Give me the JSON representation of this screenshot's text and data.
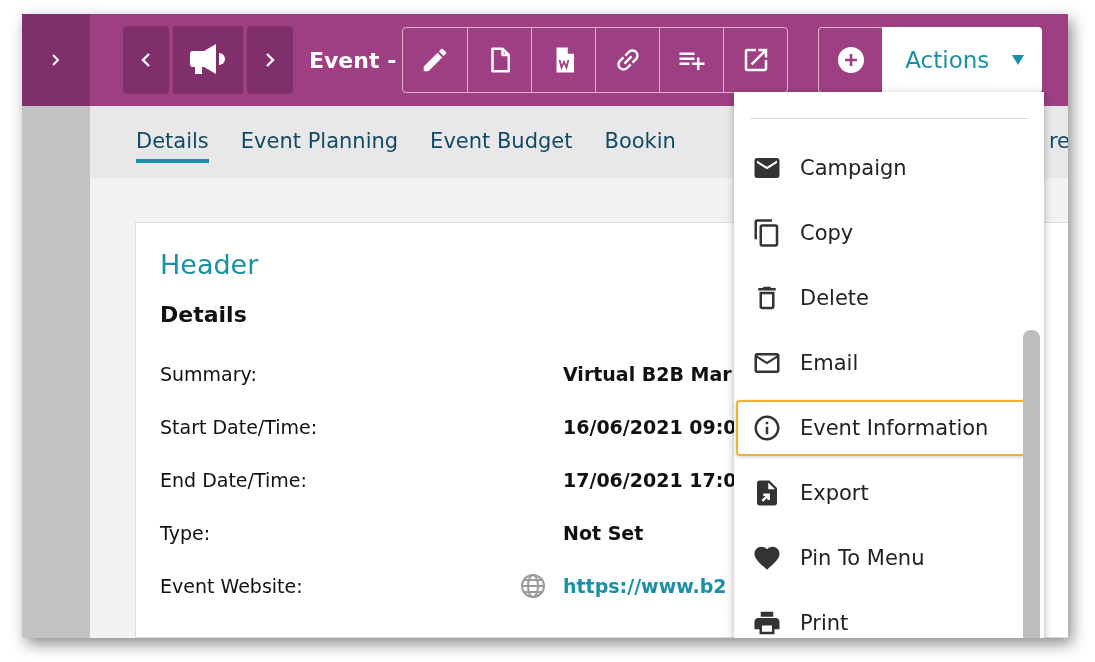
{
  "title": "Event -",
  "tabs": [
    {
      "label": "Details",
      "selected": true
    },
    {
      "label": "Event Planning",
      "selected": false
    },
    {
      "label": "Event Budget",
      "selected": false
    },
    {
      "label": "Bookin",
      "selected": false
    },
    {
      "label": "re",
      "selected": false
    }
  ],
  "actions_button": {
    "label": "Actions"
  },
  "card": {
    "heading": "Header",
    "section": "Details",
    "fields": [
      {
        "label": "Summary:",
        "value": "Virtual B2B Mar",
        "kind": "text"
      },
      {
        "label": "Start Date/Time:",
        "value": "16/06/2021 09:0",
        "kind": "text"
      },
      {
        "label": "End Date/Time:",
        "value": "17/06/2021 17:0",
        "kind": "text"
      },
      {
        "label": "Type:",
        "value": "Not Set",
        "kind": "text"
      },
      {
        "label": "Event Website:",
        "value": "https://www.b2",
        "kind": "link"
      }
    ]
  },
  "actions_menu": [
    {
      "label": "Campaign",
      "focused": false
    },
    {
      "label": "Copy",
      "focused": false
    },
    {
      "label": "Delete",
      "focused": false
    },
    {
      "label": "Email",
      "focused": false
    },
    {
      "label": "Event Information",
      "focused": true
    },
    {
      "label": "Export",
      "focused": false
    },
    {
      "label": "Pin To Menu",
      "focused": false
    },
    {
      "label": "Print",
      "focused": false
    }
  ]
}
